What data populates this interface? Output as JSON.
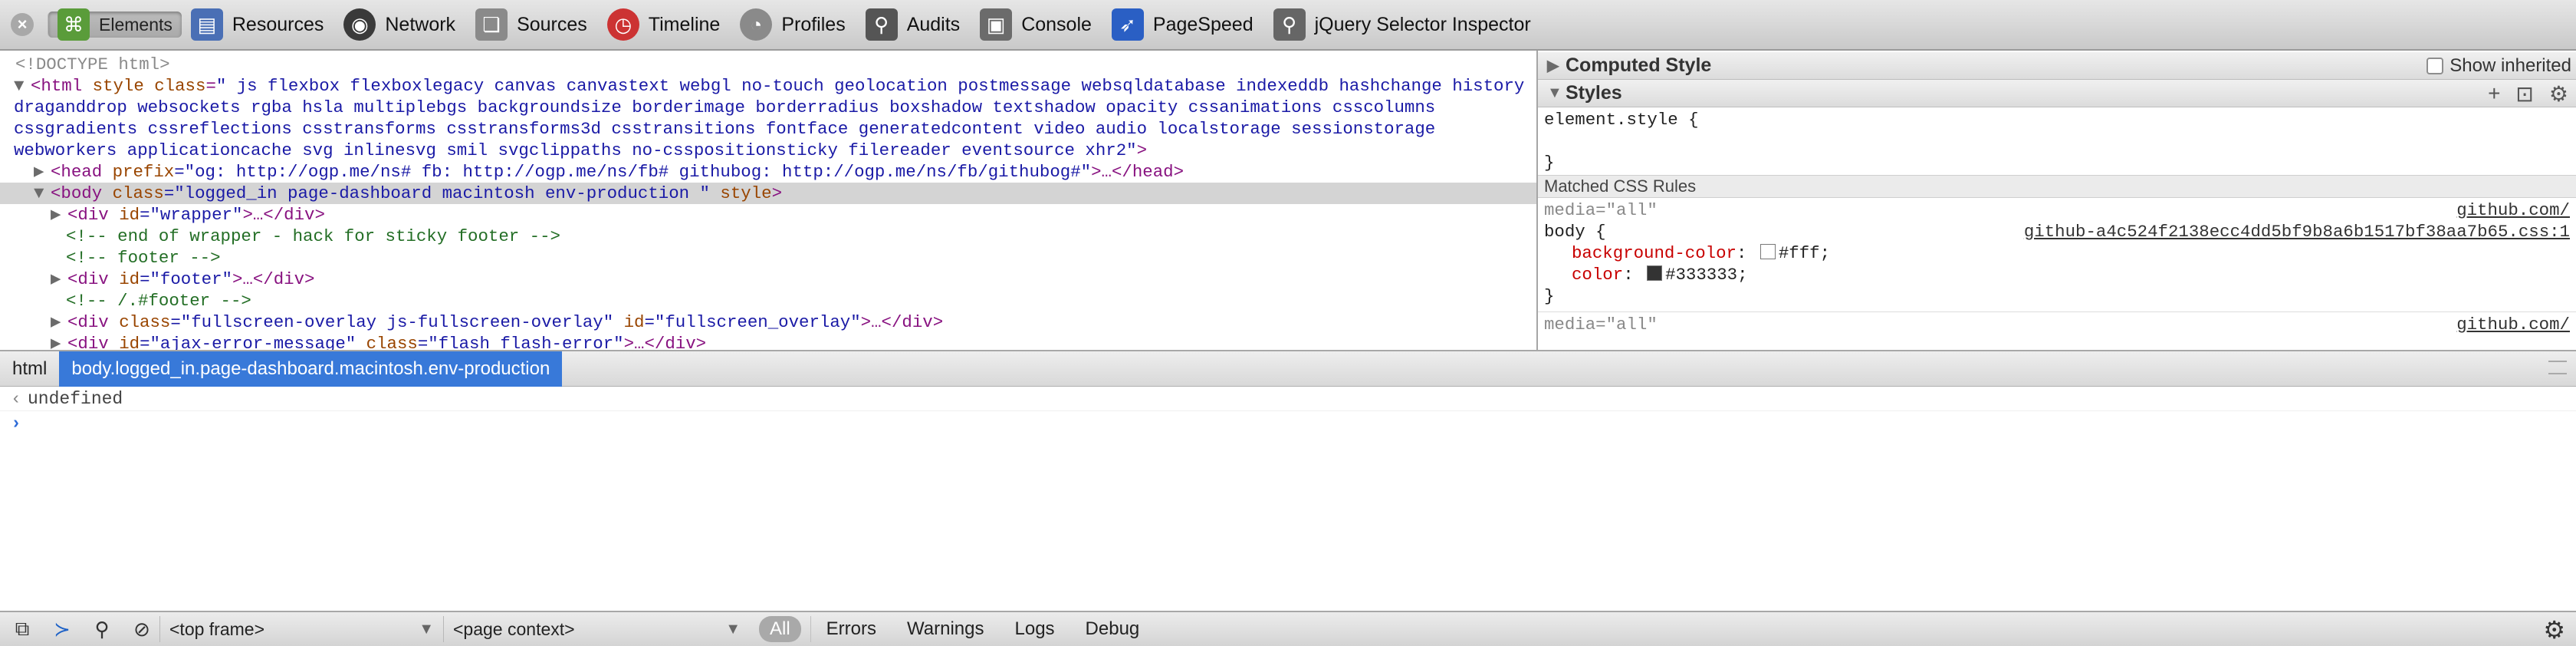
{
  "toolbar": {
    "tabs": [
      {
        "label": "Elements",
        "icon": "elements-icon",
        "color": "#5a9c3a"
      },
      {
        "label": "Resources",
        "icon": "resources-icon",
        "color": "#4a6fb5"
      },
      {
        "label": "Network",
        "icon": "network-icon",
        "color": "#3a3a3a"
      },
      {
        "label": "Sources",
        "icon": "sources-icon",
        "color": "#7a7a7a"
      },
      {
        "label": "Timeline",
        "icon": "timeline-icon",
        "color": "#c33"
      },
      {
        "label": "Profiles",
        "icon": "profiles-icon",
        "color": "#8a8a8a"
      },
      {
        "label": "Audits",
        "icon": "audits-icon",
        "color": "#555"
      },
      {
        "label": "Console",
        "icon": "console-icon",
        "color": "#6b6b6b"
      },
      {
        "label": "PageSpeed",
        "icon": "pagespeed-icon",
        "color": "#2a5fc4"
      },
      {
        "label": "jQuery Selector Inspector",
        "icon": "jquery-icon",
        "color": "#666"
      }
    ],
    "selected": "Elements",
    "close_glyph": "×"
  },
  "dom": {
    "doctype": "<!DOCTYPE html>",
    "html_open": "<html",
    "html_attr_style": "style",
    "html_attr_class": "class",
    "html_classes": "\" js flexbox flexboxlegacy canvas canvastext webgl no-touch geolocation postmessage websqldatabase indexeddb hashchange history draganddrop websockets rgba hsla multiplebgs backgroundsize borderimage borderradius boxshadow textshadow opacity cssanimations csscolumns cssgradients cssreflections csstransforms csstransforms3d csstransitions fontface generatedcontent video audio localstorage sessionstorage webworkers applicationcache svg inlinesvg smil svgclippaths no-csspositionsticky filereader eventsource xhr2\"",
    "html_close": ">",
    "head_open": "<head",
    "head_attr": "prefix",
    "head_val": "=\"og: http://ogp.me/ns# fb: http://ogp.me/ns/fb# githubog: http://ogp.me/ns/fb/githubog#\"",
    "head_rest": ">…</head>",
    "body_open": "<body",
    "body_attr": "class",
    "body_val": "=\"logged_in page-dashboard macintosh  env-production  \"",
    "body_attr2": "style",
    "body_close": ">",
    "div_wrapper_open": "<div",
    "div_wrapper_attr": "id",
    "div_wrapper_val": "=\"wrapper\"",
    "div_wrapper_rest": ">…</div>",
    "comment1": "<!-- end of wrapper - hack for sticky footer -->",
    "comment2": "<!-- footer -->",
    "div_footer_open": "<div",
    "div_footer_attr": "id",
    "div_footer_val": "=\"footer\"",
    "div_footer_rest": ">…</div>",
    "comment3": "<!-- /.#footer -->",
    "div_fs_open": "<div",
    "div_fs_attr": "class",
    "div_fs_val": "=\"fullscreen-overlay js-fullscreen-overlay\"",
    "div_fs_attr2": "id",
    "div_fs_val2": "=\"fullscreen_overlay\"",
    "div_fs_rest": ">…</div>",
    "div_ajax_open": "<div",
    "div_ajax_attr": "id",
    "div_ajax_val": "=\"ajax-error-message\"",
    "div_ajax_attr2": "class",
    "div_ajax_val2": "=\"flash flash-error\"",
    "div_ajax_rest": ">…</div>"
  },
  "side": {
    "computed_title": "Computed Style",
    "show_inherited": "Show inherited",
    "styles_title": "Styles",
    "element_style": "element.style {",
    "element_style_close": "}",
    "matched_title": "Matched CSS Rules",
    "rule1_media": "media=\"all\"",
    "rule1_link1": "github.com/",
    "rule1_selector": "body {",
    "rule1_link2": "github-a4c524f2138ecc4dd5bf9b8a6b1517bf38aa7b65.css:1",
    "rule1_prop1": "background-color",
    "rule1_val1": "#fff;",
    "rule1_prop2": "color",
    "rule1_val2": "#333333;",
    "rule1_close": "}",
    "rule2_media": "media=\"all\"",
    "rule2_link1": "github.com/",
    "swatch1": "#ffffff",
    "swatch2": "#333333"
  },
  "breadcrumbs": [
    {
      "label": "html"
    },
    {
      "label": "body.logged_in.page-dashboard.macintosh.env-production"
    }
  ],
  "console": {
    "output": "undefined",
    "prompt_glyph": "›",
    "result_glyph": "‹"
  },
  "status": {
    "frame": "<top frame>",
    "context": "<page context>",
    "filters": [
      "All",
      "Errors",
      "Warnings",
      "Logs",
      "Debug"
    ]
  }
}
